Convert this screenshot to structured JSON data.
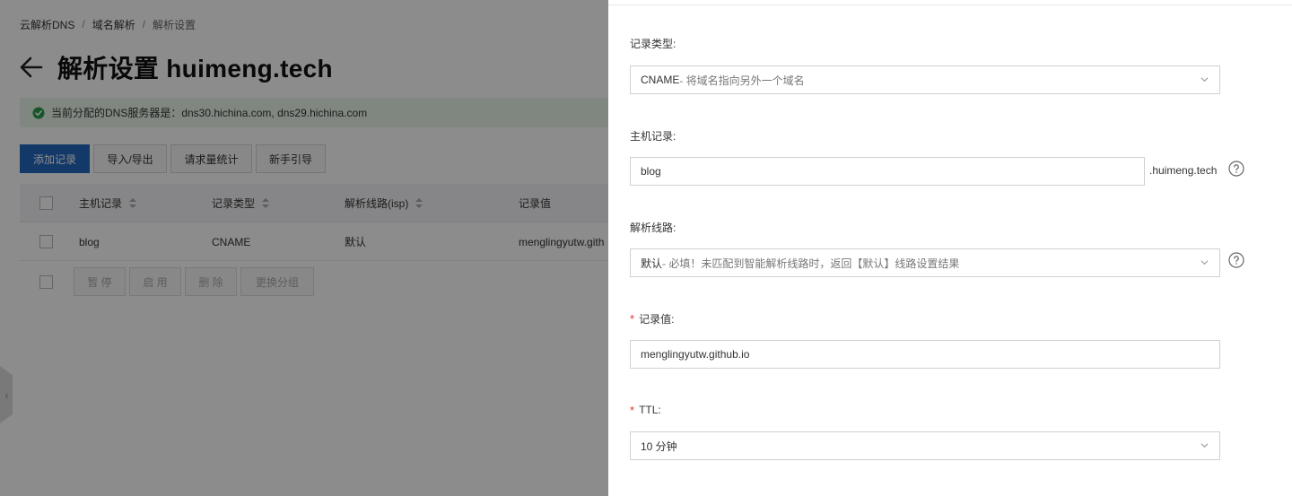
{
  "breadcrumb": {
    "item1": "云解析DNS",
    "item2": "域名解析",
    "item3": "解析设置",
    "sep": "/"
  },
  "page": {
    "title": "解析设置 huimeng.tech"
  },
  "alert": {
    "text": "当前分配的DNS服务器是：dns30.hichina.com, dns29.hichina.com"
  },
  "toolbar": {
    "add": "添加记录",
    "import_export": "导入/导出",
    "stats": "请求量统计",
    "guide": "新手引导"
  },
  "table": {
    "headers": {
      "host": "主机记录",
      "type": "记录类型",
      "line": "解析线路(isp)",
      "value": "记录值"
    },
    "rows": [
      {
        "host": "blog",
        "type": "CNAME",
        "line": "默认",
        "value": "menglingyutw.gith"
      }
    ]
  },
  "bulk": {
    "pause": "暂 停",
    "enable": "启 用",
    "delete": "删 除",
    "change_group": "更换分组"
  },
  "drawer": {
    "record_type": {
      "label": "记录类型:",
      "value": "CNAME",
      "desc": "- 将域名指向另外一个域名"
    },
    "host": {
      "label": "主机记录:",
      "value": "blog",
      "suffix": ".huimeng.tech"
    },
    "line": {
      "label": "解析线路:",
      "value": "默认",
      "desc": " - 必填！未匹配到智能解析线路时，返回【默认】线路设置结果"
    },
    "record_value": {
      "label": "记录值:",
      "value": "menglingyutw.github.io",
      "required_mark": "*"
    },
    "ttl": {
      "label": "TTL:",
      "value": "10 分钟",
      "required_mark": "*"
    }
  },
  "colors": {
    "primary": "#2468c0",
    "success": "#2a9d4a",
    "required": "#e3342f"
  }
}
